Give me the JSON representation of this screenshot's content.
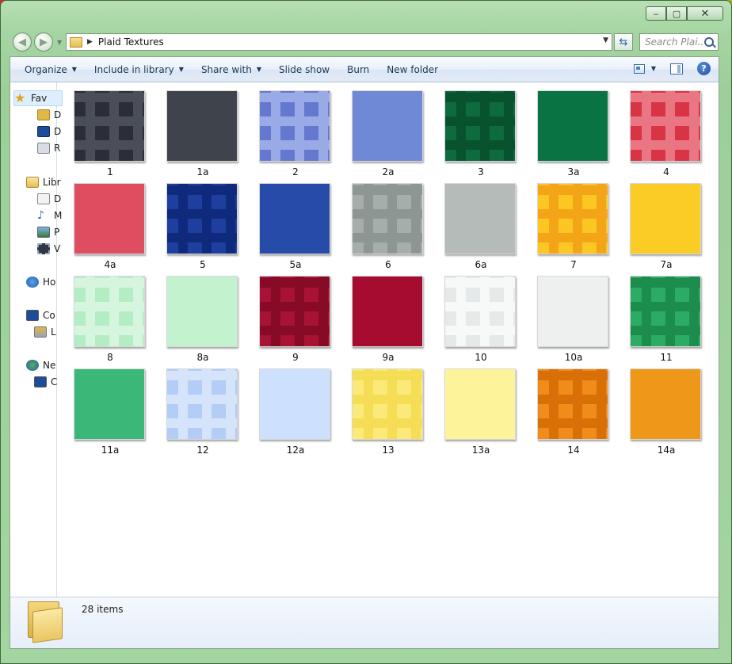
{
  "window": {
    "controls": {
      "minimize": "‒",
      "maximize": "▢",
      "close": "✕"
    }
  },
  "address": {
    "path": "Plaid Textures"
  },
  "search": {
    "placeholder": "Search Plai..."
  },
  "toolbar": {
    "items": [
      {
        "label": "Organize",
        "dropdown": true
      },
      {
        "label": "Include in library",
        "dropdown": true
      },
      {
        "label": "Share with",
        "dropdown": true
      },
      {
        "label": "Slide show",
        "dropdown": false
      },
      {
        "label": "Burn",
        "dropdown": false
      },
      {
        "label": "New folder",
        "dropdown": false
      }
    ]
  },
  "navpane": {
    "favorites": "Fav",
    "fav_items": [
      "D",
      "D",
      "R"
    ],
    "libraries": "Libr",
    "lib_items": [
      "D",
      "M",
      "P",
      "V"
    ],
    "homegroup": "Ho",
    "computer": "Co",
    "computer_items": [
      "L"
    ],
    "network": "Ne",
    "network_items": [
      "C"
    ]
  },
  "files": [
    {
      "name": "1",
      "base": "#2b2e36",
      "line": "#4a4e58",
      "plaid": true
    },
    {
      "name": "1a",
      "base": "#3f434c",
      "plaid": false
    },
    {
      "name": "2",
      "base": "#6478d0",
      "line": "#9aaae6",
      "plaid": true
    },
    {
      "name": "2a",
      "base": "#7089d6",
      "plaid": false
    },
    {
      "name": "3",
      "base": "#0d6b3d",
      "line": "#095230",
      "plaid": true
    },
    {
      "name": "3a",
      "base": "#0a7343",
      "plaid": false
    },
    {
      "name": "4",
      "base": "#d93446",
      "line": "#ea7683",
      "plaid": true
    },
    {
      "name": "4a",
      "base": "#df4d60",
      "plaid": false
    },
    {
      "name": "5",
      "base": "#1f3f9e",
      "line": "#0f2a7d",
      "plaid": true
    },
    {
      "name": "5a",
      "base": "#264ba8",
      "plaid": false
    },
    {
      "name": "6",
      "base": "#a6aeab",
      "line": "#8d9693",
      "plaid": true
    },
    {
      "name": "6a",
      "base": "#b4bbb9",
      "plaid": false
    },
    {
      "name": "7",
      "base": "#fcc623",
      "line": "#f4a417",
      "plaid": true
    },
    {
      "name": "7a",
      "base": "#fccc26",
      "plaid": false
    },
    {
      "name": "8",
      "base": "#b4edc4",
      "line": "#d6f5df",
      "plaid": true
    },
    {
      "name": "8a",
      "base": "#c3f2cf",
      "plaid": false
    },
    {
      "name": "9",
      "base": "#a81234",
      "line": "#870b26",
      "plaid": true
    },
    {
      "name": "9a",
      "base": "#a60b30",
      "plaid": false
    },
    {
      "name": "10",
      "base": "#e6e9e9",
      "line": "#f7f8f8",
      "plaid": true
    },
    {
      "name": "10a",
      "base": "#eef0f0",
      "plaid": false
    },
    {
      "name": "11",
      "base": "#2bab63",
      "line": "#1d8d4d",
      "plaid": true
    },
    {
      "name": "11a",
      "base": "#3bb878",
      "plaid": false
    },
    {
      "name": "12",
      "base": "#b3cdf7",
      "line": "#d6e4fb",
      "plaid": true
    },
    {
      "name": "12a",
      "base": "#cde0fd",
      "plaid": false
    },
    {
      "name": "13",
      "base": "#fbe97a",
      "line": "#f5dd55",
      "plaid": true
    },
    {
      "name": "13a",
      "base": "#fdf39b",
      "plaid": false
    },
    {
      "name": "14",
      "base": "#f08c1a",
      "line": "#d96f07",
      "plaid": true
    },
    {
      "name": "14a",
      "base": "#ef9718",
      "plaid": false
    }
  ],
  "status": {
    "count": "28 items"
  }
}
